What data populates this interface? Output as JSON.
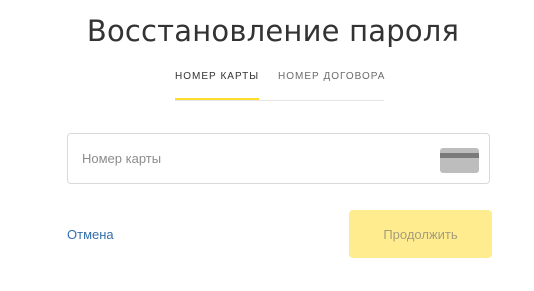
{
  "page": {
    "title": "Восстановление пароля"
  },
  "tabs": [
    {
      "label": "НОМЕР КАРТЫ",
      "active": true
    },
    {
      "label": "НОМЕР ДОГОВОРА",
      "active": false
    }
  ],
  "card_field": {
    "placeholder": "Номер карты",
    "value": "",
    "icon": "credit-card-icon"
  },
  "actions": {
    "cancel_label": "Отмена",
    "continue_label": "Продолжить"
  },
  "colors": {
    "accent": "#ffdd2d",
    "button_disabled_bg": "#ffec8f",
    "link": "#336fab"
  }
}
